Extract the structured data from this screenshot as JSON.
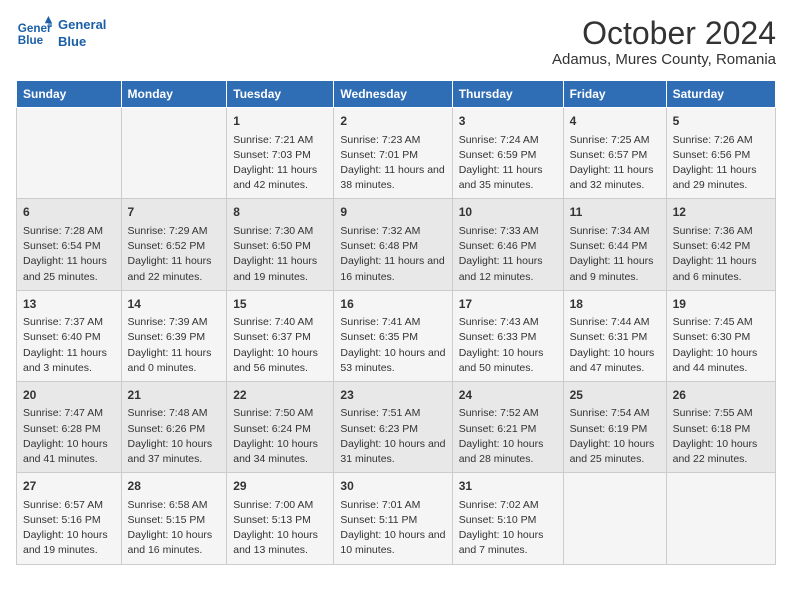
{
  "header": {
    "logo_line1": "General",
    "logo_line2": "Blue",
    "title": "October 2024",
    "subtitle": "Adamus, Mures County, Romania"
  },
  "weekdays": [
    "Sunday",
    "Monday",
    "Tuesday",
    "Wednesday",
    "Thursday",
    "Friday",
    "Saturday"
  ],
  "weeks": [
    [
      {
        "day": "",
        "info": ""
      },
      {
        "day": "",
        "info": ""
      },
      {
        "day": "1",
        "info": "Sunrise: 7:21 AM\nSunset: 7:03 PM\nDaylight: 11 hours and 42 minutes."
      },
      {
        "day": "2",
        "info": "Sunrise: 7:23 AM\nSunset: 7:01 PM\nDaylight: 11 hours and 38 minutes."
      },
      {
        "day": "3",
        "info": "Sunrise: 7:24 AM\nSunset: 6:59 PM\nDaylight: 11 hours and 35 minutes."
      },
      {
        "day": "4",
        "info": "Sunrise: 7:25 AM\nSunset: 6:57 PM\nDaylight: 11 hours and 32 minutes."
      },
      {
        "day": "5",
        "info": "Sunrise: 7:26 AM\nSunset: 6:56 PM\nDaylight: 11 hours and 29 minutes."
      }
    ],
    [
      {
        "day": "6",
        "info": "Sunrise: 7:28 AM\nSunset: 6:54 PM\nDaylight: 11 hours and 25 minutes."
      },
      {
        "day": "7",
        "info": "Sunrise: 7:29 AM\nSunset: 6:52 PM\nDaylight: 11 hours and 22 minutes."
      },
      {
        "day": "8",
        "info": "Sunrise: 7:30 AM\nSunset: 6:50 PM\nDaylight: 11 hours and 19 minutes."
      },
      {
        "day": "9",
        "info": "Sunrise: 7:32 AM\nSunset: 6:48 PM\nDaylight: 11 hours and 16 minutes."
      },
      {
        "day": "10",
        "info": "Sunrise: 7:33 AM\nSunset: 6:46 PM\nDaylight: 11 hours and 12 minutes."
      },
      {
        "day": "11",
        "info": "Sunrise: 7:34 AM\nSunset: 6:44 PM\nDaylight: 11 hours and 9 minutes."
      },
      {
        "day": "12",
        "info": "Sunrise: 7:36 AM\nSunset: 6:42 PM\nDaylight: 11 hours and 6 minutes."
      }
    ],
    [
      {
        "day": "13",
        "info": "Sunrise: 7:37 AM\nSunset: 6:40 PM\nDaylight: 11 hours and 3 minutes."
      },
      {
        "day": "14",
        "info": "Sunrise: 7:39 AM\nSunset: 6:39 PM\nDaylight: 11 hours and 0 minutes."
      },
      {
        "day": "15",
        "info": "Sunrise: 7:40 AM\nSunset: 6:37 PM\nDaylight: 10 hours and 56 minutes."
      },
      {
        "day": "16",
        "info": "Sunrise: 7:41 AM\nSunset: 6:35 PM\nDaylight: 10 hours and 53 minutes."
      },
      {
        "day": "17",
        "info": "Sunrise: 7:43 AM\nSunset: 6:33 PM\nDaylight: 10 hours and 50 minutes."
      },
      {
        "day": "18",
        "info": "Sunrise: 7:44 AM\nSunset: 6:31 PM\nDaylight: 10 hours and 47 minutes."
      },
      {
        "day": "19",
        "info": "Sunrise: 7:45 AM\nSunset: 6:30 PM\nDaylight: 10 hours and 44 minutes."
      }
    ],
    [
      {
        "day": "20",
        "info": "Sunrise: 7:47 AM\nSunset: 6:28 PM\nDaylight: 10 hours and 41 minutes."
      },
      {
        "day": "21",
        "info": "Sunrise: 7:48 AM\nSunset: 6:26 PM\nDaylight: 10 hours and 37 minutes."
      },
      {
        "day": "22",
        "info": "Sunrise: 7:50 AM\nSunset: 6:24 PM\nDaylight: 10 hours and 34 minutes."
      },
      {
        "day": "23",
        "info": "Sunrise: 7:51 AM\nSunset: 6:23 PM\nDaylight: 10 hours and 31 minutes."
      },
      {
        "day": "24",
        "info": "Sunrise: 7:52 AM\nSunset: 6:21 PM\nDaylight: 10 hours and 28 minutes."
      },
      {
        "day": "25",
        "info": "Sunrise: 7:54 AM\nSunset: 6:19 PM\nDaylight: 10 hours and 25 minutes."
      },
      {
        "day": "26",
        "info": "Sunrise: 7:55 AM\nSunset: 6:18 PM\nDaylight: 10 hours and 22 minutes."
      }
    ],
    [
      {
        "day": "27",
        "info": "Sunrise: 6:57 AM\nSunset: 5:16 PM\nDaylight: 10 hours and 19 minutes."
      },
      {
        "day": "28",
        "info": "Sunrise: 6:58 AM\nSunset: 5:15 PM\nDaylight: 10 hours and 16 minutes."
      },
      {
        "day": "29",
        "info": "Sunrise: 7:00 AM\nSunset: 5:13 PM\nDaylight: 10 hours and 13 minutes."
      },
      {
        "day": "30",
        "info": "Sunrise: 7:01 AM\nSunset: 5:11 PM\nDaylight: 10 hours and 10 minutes."
      },
      {
        "day": "31",
        "info": "Sunrise: 7:02 AM\nSunset: 5:10 PM\nDaylight: 10 hours and 7 minutes."
      },
      {
        "day": "",
        "info": ""
      },
      {
        "day": "",
        "info": ""
      }
    ]
  ]
}
